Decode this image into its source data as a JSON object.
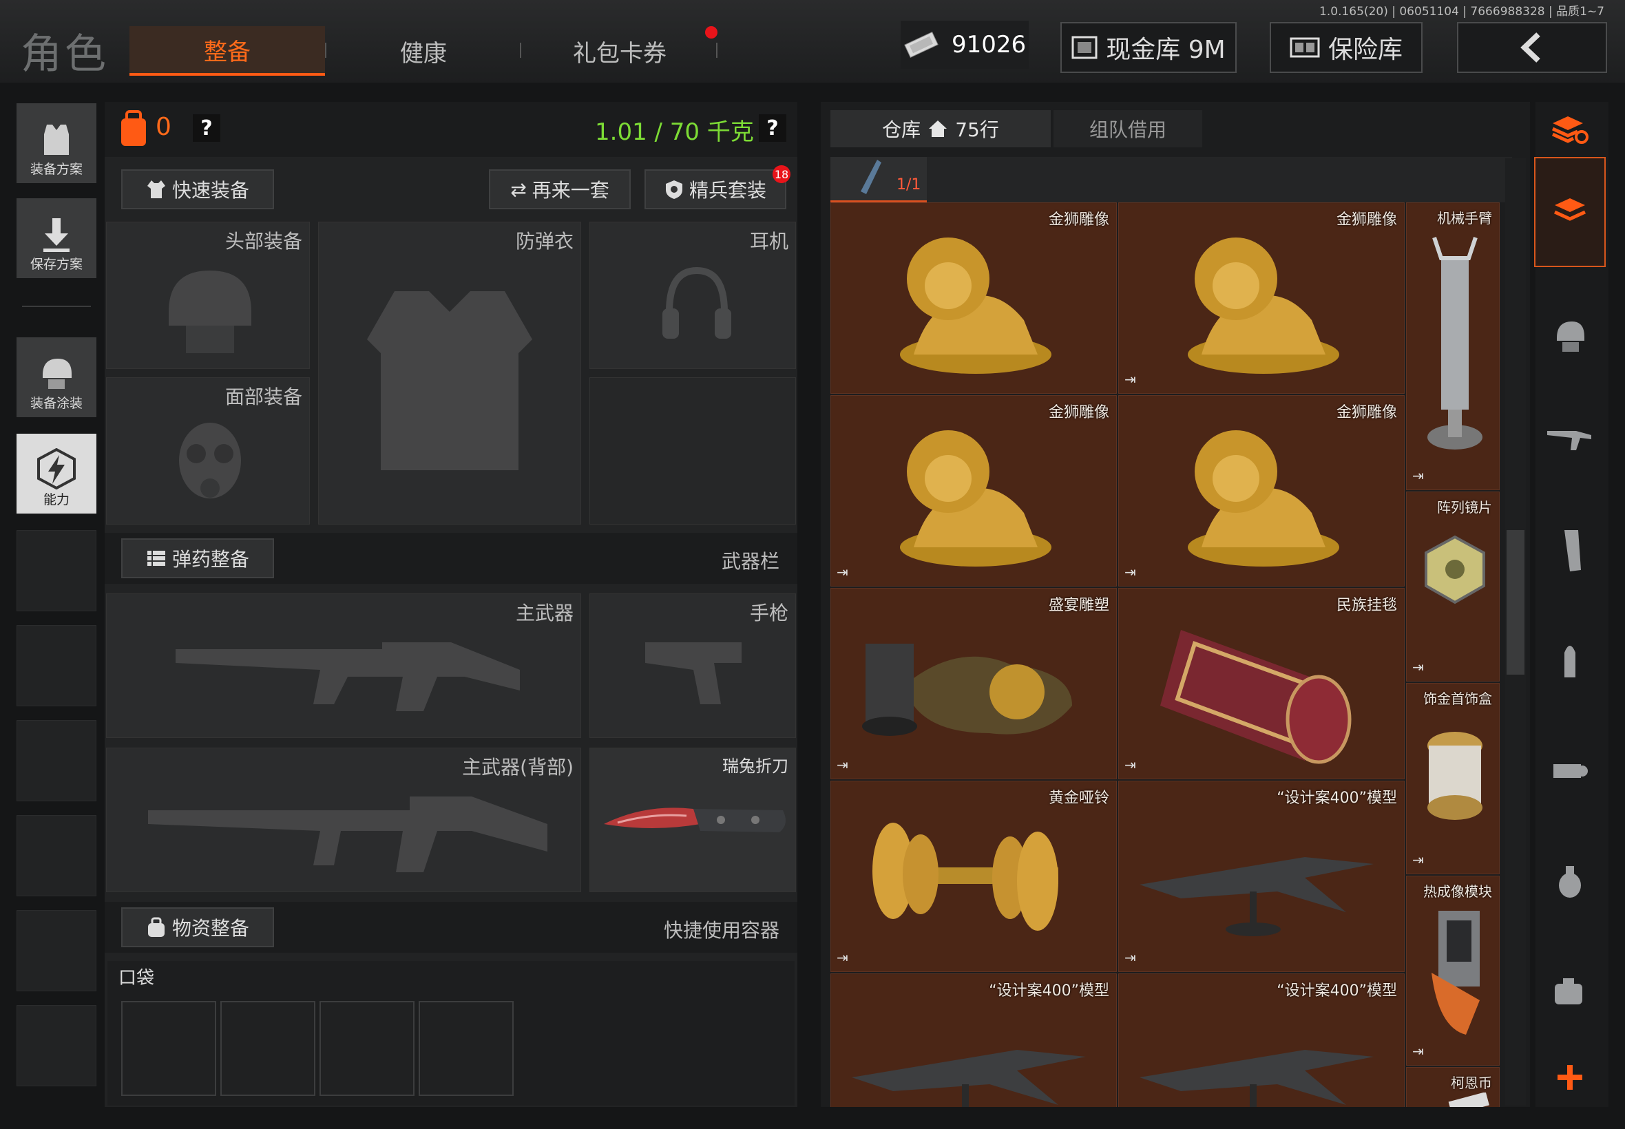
{
  "header": {
    "version": "1.0.165(20) | 06051104 | 7666988328 | 品质1~7",
    "title": "角色",
    "tabs": [
      {
        "label": "整备",
        "active": true
      },
      {
        "label": "健康",
        "active": false
      },
      {
        "label": "礼包卡券",
        "active": false
      }
    ],
    "money": "91026",
    "cash_vault": "现金库 9M",
    "safe": "保险库"
  },
  "sidebar": {
    "items": [
      {
        "label": "装备方案",
        "icon": "vest-icon"
      },
      {
        "label": "保存方案",
        "icon": "download-icon"
      },
      {
        "label": "装备涂装",
        "icon": "helmet-paint-icon"
      },
      {
        "label": "能力",
        "icon": "lightning-icon"
      }
    ]
  },
  "loadout": {
    "backpack_count": "0",
    "help": "?",
    "weight": "1.01 / 70 千克",
    "quick_equip": "快速装备",
    "reroll": "再来一套",
    "elite_set": "精兵套装",
    "elite_badge": "18",
    "slots": {
      "head": "头部装备",
      "armor": "防弹衣",
      "headset": "耳机",
      "face": "面部装备"
    },
    "ammo_equip": "弹药整备",
    "weapon_bar": "武器栏",
    "weapons": {
      "primary": "主武器",
      "pistol": "手枪",
      "primary_back": "主武器(背部)",
      "knife": "瑞兔折刀"
    },
    "supply_equip": "物资整备",
    "quick_container": "快捷使用容器",
    "pocket": "口袋"
  },
  "warehouse": {
    "tab_storage": "仓库",
    "rows": "75行",
    "tab_team": "组队借用",
    "page": "1/1",
    "items": [
      {
        "name": "金狮雕像"
      },
      {
        "name": "金狮雕像"
      },
      {
        "name": "机械手臂"
      },
      {
        "name": "金狮雕像"
      },
      {
        "name": "金狮雕像"
      },
      {
        "name": "阵列镜片"
      },
      {
        "name": "盛宴雕塑"
      },
      {
        "name": "民族挂毯"
      },
      {
        "name": "饰金首饰盒"
      },
      {
        "name": "黄金哑铃"
      },
      {
        "name": "“设计案400”模型"
      },
      {
        "name": "热成像模块"
      },
      {
        "name": "“设计案400”模型"
      },
      {
        "name": "“设计案400”模型"
      },
      {
        "name": "柯恩币"
      }
    ]
  },
  "colors": {
    "accent": "#ff5a14",
    "weight": "#7ddc35",
    "item_bg": "#4b2616"
  }
}
